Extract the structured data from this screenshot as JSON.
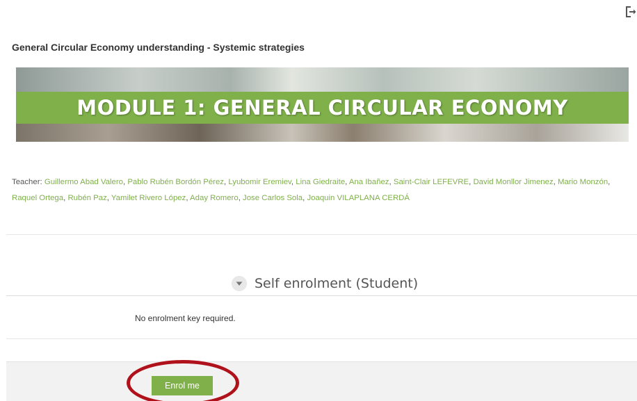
{
  "header": {
    "logout_icon": "logout-icon"
  },
  "course": {
    "title": "General Circular Economy understanding - Systemic strategies",
    "banner_text": "MODULE 1: GENERAL CIRCULAR ECONOMY"
  },
  "teachers": {
    "label": "Teacher: ",
    "names": [
      "Guillermo Abad Valero",
      "Pablo Rubén Bordón Pérez",
      "Lyubomir Eremiev",
      "Lina Giedraite",
      "Ana Ibañez",
      "Saint-Clair LEFEVRE",
      "David Monllor Jimenez",
      "Mario Monzón",
      "Raquel Ortega",
      "Rubén Paz",
      "Yamilet Rivero López",
      "Aday Romero",
      "Jose Carlos Sola",
      "Joaquin VILAPLANA CERDÁ"
    ]
  },
  "enrolment": {
    "section_title": "Self enrolment (Student)",
    "no_key_text": "No enrolment key required.",
    "button_label": "Enrol me"
  },
  "colors": {
    "accent_green": "#7fb04a",
    "annotation_red": "#b0121b"
  }
}
